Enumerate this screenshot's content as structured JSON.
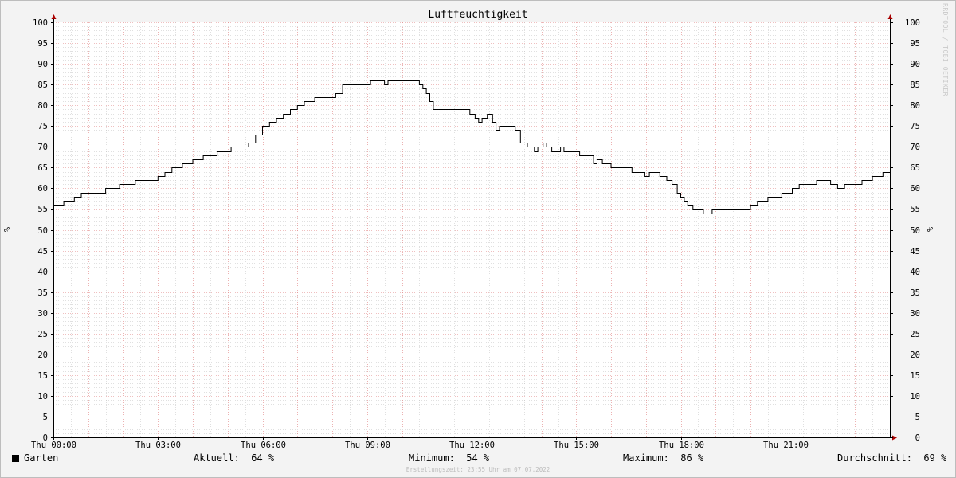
{
  "credit": "RRDTOOL / TOBI OETIKER",
  "chart_data": {
    "type": "line",
    "title": "Luftfeuchtigkeit",
    "ylabel": "%",
    "ylabel_right": "%",
    "ylim": [
      0,
      100
    ],
    "y_ticks": [
      0,
      5,
      10,
      15,
      20,
      25,
      30,
      35,
      40,
      45,
      50,
      55,
      60,
      65,
      70,
      75,
      80,
      85,
      90,
      95,
      100
    ],
    "xlim": [
      0,
      24
    ],
    "x_tick_values": [
      0,
      3,
      6,
      9,
      12,
      15,
      18,
      21
    ],
    "x_tick_labels": [
      "Thu 00:00",
      "Thu 03:00",
      "Thu 06:00",
      "Thu 09:00",
      "Thu 12:00",
      "Thu 15:00",
      "Thu 18:00",
      "Thu 21:00"
    ],
    "grid": true,
    "series": [
      {
        "name": "Garten",
        "color": "#000000",
        "x": [
          0,
          0.3,
          0.6,
          0.8,
          1.2,
          1.5,
          1.9,
          2.35,
          2.7,
          3.0,
          3.2,
          3.4,
          3.7,
          4.0,
          4.3,
          4.7,
          5.1,
          5.6,
          5.8,
          6.0,
          6.2,
          6.4,
          6.6,
          6.8,
          7.0,
          7.2,
          7.5,
          8.0,
          8.1,
          8.3,
          9.0,
          9.1,
          9.45,
          9.5,
          9.6,
          10.5,
          10.6,
          10.7,
          10.8,
          10.9,
          11.2,
          11.95,
          12.1,
          12.2,
          12.3,
          12.45,
          12.6,
          12.7,
          12.8,
          13.1,
          13.25,
          13.4,
          13.5,
          13.6,
          13.8,
          13.9,
          14.05,
          14.15,
          14.3,
          14.55,
          14.65,
          15.1,
          15.5,
          15.6,
          15.75,
          16.0,
          16.6,
          16.8,
          16.95,
          17.1,
          17.4,
          17.6,
          17.75,
          17.9,
          18.0,
          18.1,
          18.2,
          18.35,
          18.5,
          18.65,
          18.9,
          19.1,
          19.2,
          19.5,
          20.0,
          20.2,
          20.5,
          20.9,
          21.2,
          21.4,
          21.7,
          21.9,
          22.3,
          22.5,
          22.7,
          22.9,
          23.2,
          23.5,
          23.8,
          23.95
        ],
        "values": [
          56,
          57,
          58,
          59,
          59,
          60,
          61,
          62,
          62,
          63,
          64,
          65,
          66,
          67,
          68,
          69,
          70,
          71,
          73,
          75,
          76,
          77,
          78,
          79,
          80,
          81,
          82,
          82,
          83,
          85,
          85,
          86,
          86,
          85,
          86,
          85,
          84,
          83,
          81,
          79,
          79,
          78,
          77,
          76,
          77,
          78,
          76,
          74,
          75,
          75,
          74,
          71,
          71,
          70,
          69,
          70,
          71,
          70,
          69,
          70,
          69,
          68,
          66,
          67,
          66,
          65,
          64,
          64,
          63,
          64,
          63,
          62,
          61,
          59,
          58,
          57,
          56,
          55,
          55,
          54,
          55,
          55,
          55,
          55,
          56,
          57,
          58,
          59,
          60,
          61,
          61,
          62,
          61,
          60,
          61,
          61,
          62,
          63,
          64,
          64
        ]
      }
    ]
  },
  "legend": {
    "series_name": "Garten",
    "series_color": "#000000",
    "current": "Aktuell:  64 %",
    "minimum": "Minimum:  54 %",
    "maximum": "Maximum:  86 %",
    "average": "Durchschnitt:  69 %"
  },
  "footer": "Erstellungszeit: 23:55 Uhr am 07.07.2022",
  "colors": {
    "background": "#f3f3f3",
    "plot_background": "#ffffff",
    "major_grid": "#e08080",
    "minor_grid": "#c0c0c0",
    "axis": "#000000",
    "arrow": "#aa0000"
  }
}
